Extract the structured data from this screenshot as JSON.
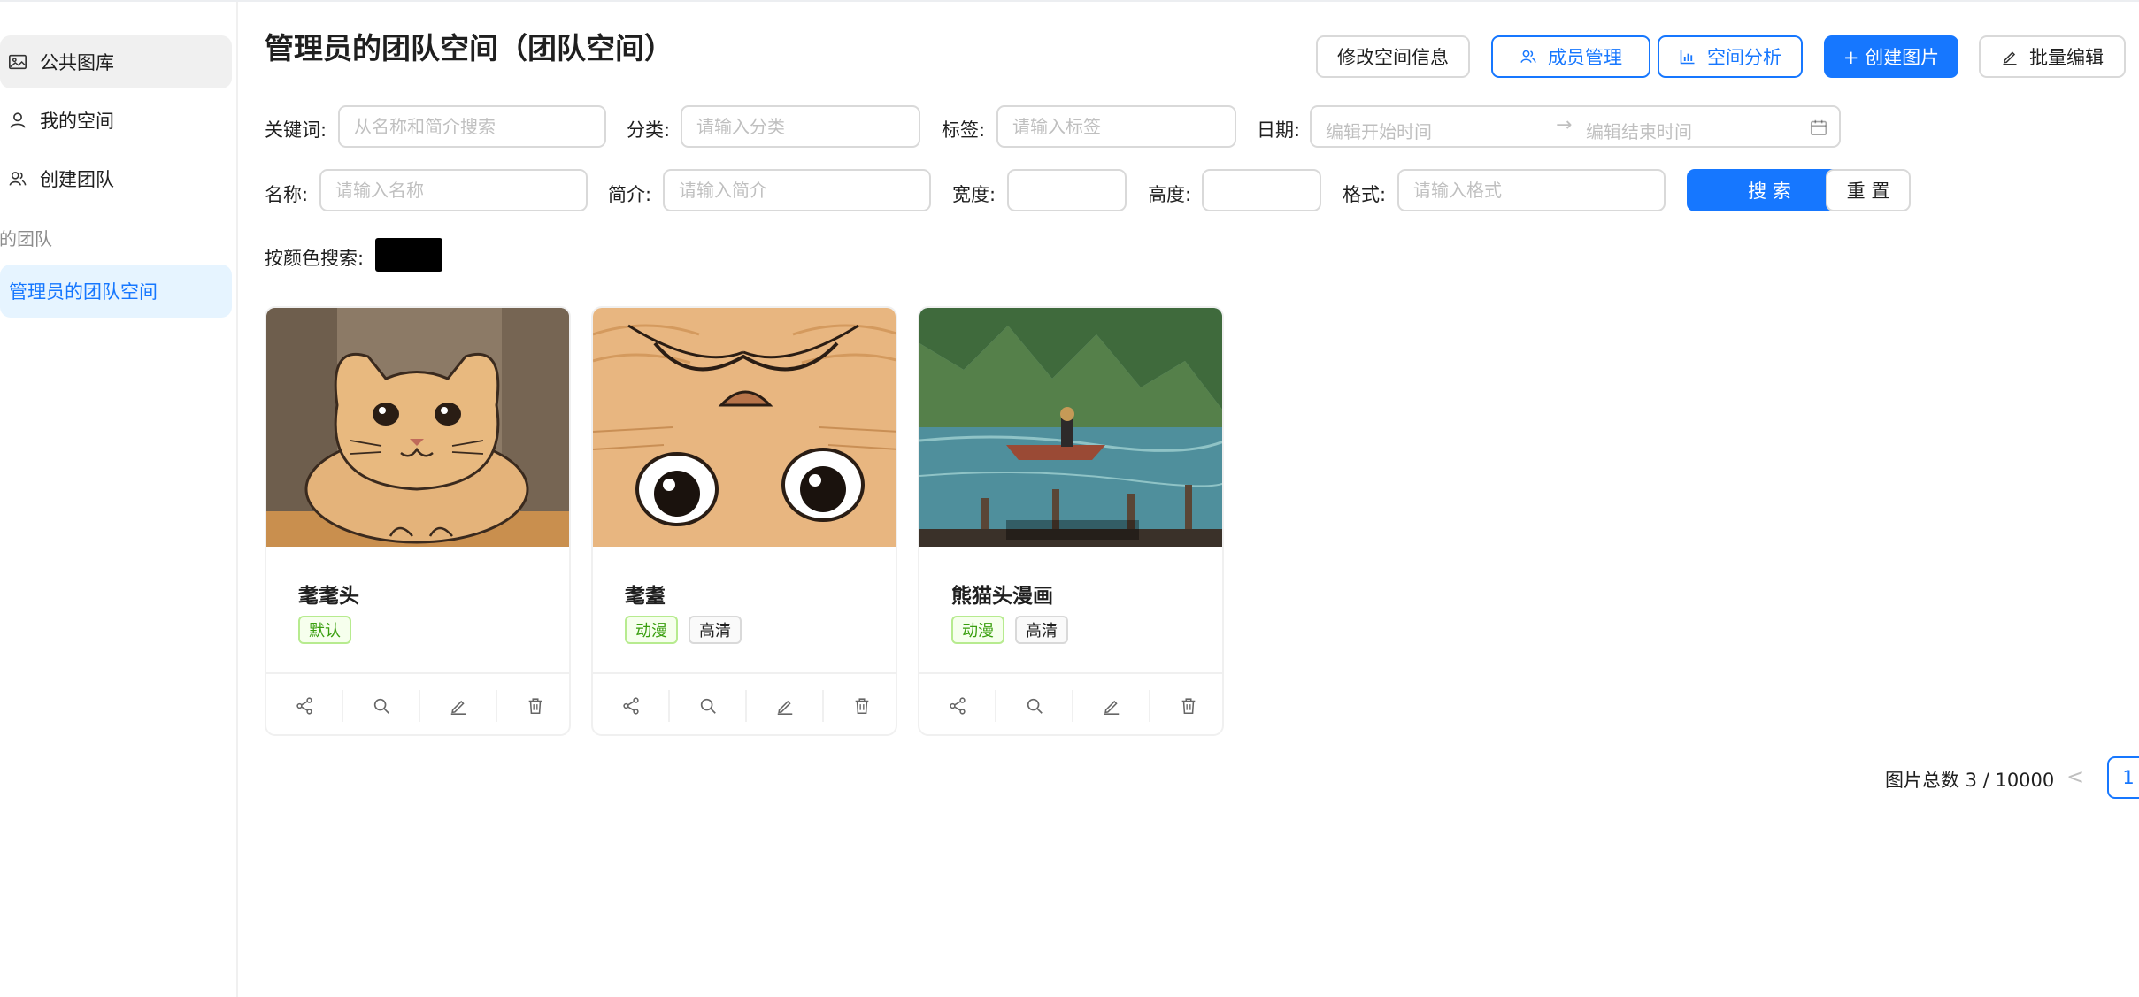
{
  "sidebar": {
    "items": [
      {
        "label": "公共图库",
        "icon": "picture-icon"
      },
      {
        "label": "我的空间",
        "icon": "user-icon"
      },
      {
        "label": "创建团队",
        "icon": "team-icon"
      }
    ],
    "group_title": "我的团队",
    "team_item": {
      "label": "管理员的团队空间"
    }
  },
  "header": {
    "title": "管理员的团队空间（团队空间）",
    "buttons": {
      "edit_space": "修改空间信息",
      "member_manage": "成员管理",
      "space_analysis": "空间分析",
      "create_picture": "+ 创建图片",
      "batch_edit": "批量编辑"
    }
  },
  "filters": {
    "keyword": {
      "label": "关键词:",
      "placeholder": "从名称和简介搜索"
    },
    "category": {
      "label": "分类:",
      "placeholder": "请输入分类"
    },
    "tags": {
      "label": "标签:",
      "placeholder": "请输入标签"
    },
    "date": {
      "label": "日期:",
      "start_placeholder": "编辑开始时间",
      "arrow": "→",
      "end_placeholder": "编辑结束时间"
    },
    "name": {
      "label": "名称:",
      "placeholder": "请输入名称"
    },
    "intro": {
      "label": "简介:",
      "placeholder": "请输入简介"
    },
    "width": {
      "label": "宽度:",
      "value": ""
    },
    "height": {
      "label": "高度:",
      "value": ""
    },
    "format": {
      "label": "格式:",
      "placeholder": "请输入格式"
    },
    "search_button": "搜 索",
    "reset_button": "重 置",
    "color_search": {
      "label": "按颜色搜索:",
      "color": "#000000"
    }
  },
  "cards": [
    {
      "title": "耄耄头",
      "tags": [
        {
          "label": "默认",
          "style": "green"
        }
      ]
    },
    {
      "title": "耄耋",
      "tags": [
        {
          "label": "动漫",
          "style": "green"
        },
        {
          "label": "高清",
          "style": "grey"
        }
      ]
    },
    {
      "title": "熊猫头漫画",
      "tags": [
        {
          "label": "动漫",
          "style": "green"
        },
        {
          "label": "高清",
          "style": "grey"
        }
      ]
    }
  ],
  "card_actions": [
    "share-icon",
    "search-icon",
    "edit-icon",
    "delete-icon"
  ],
  "pagination": {
    "total_text": "图片总数 3 / 10000",
    "prev": "<",
    "current_page": "1"
  },
  "colors": {
    "primary": "#1677ff",
    "tag_green": "#389e0d",
    "selected_menu_bg": "#e6f4ff"
  }
}
